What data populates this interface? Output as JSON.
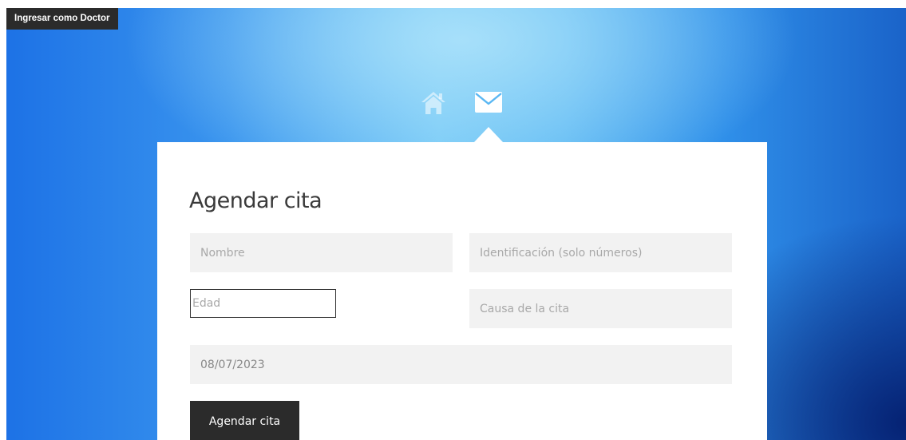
{
  "header": {
    "doctor_login_label": "Ingresar como Doctor"
  },
  "nav": {
    "items": [
      {
        "icon": "home-icon",
        "active": false
      },
      {
        "icon": "envelope-icon",
        "active": true
      }
    ]
  },
  "form": {
    "title": "Agendar cita",
    "fields": {
      "nombre": {
        "placeholder": "Nombre",
        "value": ""
      },
      "identificacion": {
        "placeholder": "Identificación (solo números)",
        "value": ""
      },
      "edad": {
        "placeholder": "Edad",
        "value": ""
      },
      "causa": {
        "placeholder": "Causa de la cita",
        "value": ""
      },
      "fecha": {
        "value": "08/07/2023"
      }
    },
    "submit_label": "Agendar cita"
  },
  "colors": {
    "dark_button": "#2b2b2b",
    "field_background": "#f2f2f2",
    "card_background": "#ffffff",
    "background_light_blue": "#6fc6f6",
    "background_mid_blue": "#1d72e6",
    "background_dark_blue": "#041e6e"
  }
}
